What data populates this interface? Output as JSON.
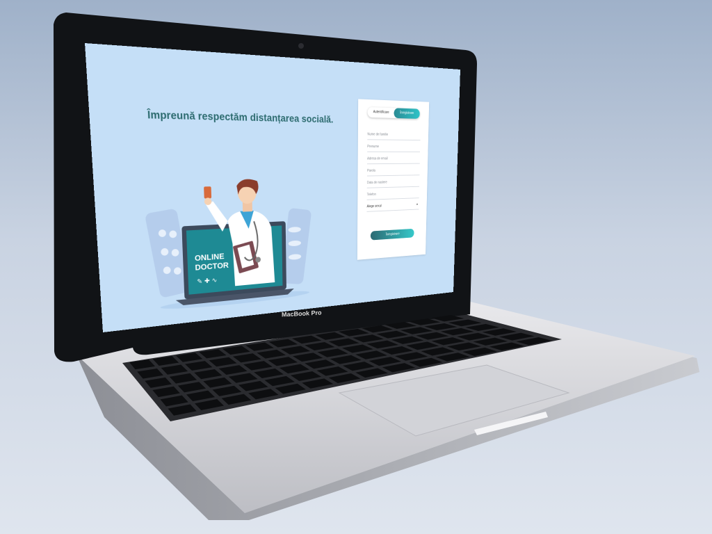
{
  "device": {
    "brand_label": "MacBook Pro"
  },
  "screen": {
    "tagline": "Împreună respectăm distanțarea socială.",
    "illustration": {
      "monitor_text_line1": "ONLINE",
      "monitor_text_line2": "DOCTOR"
    },
    "form": {
      "tabs": [
        {
          "label": "Autentificare",
          "active": false
        },
        {
          "label": "Înregistrare",
          "active": true
        }
      ],
      "fields": [
        {
          "placeholder": "Nume de familie"
        },
        {
          "placeholder": "Prenume"
        },
        {
          "placeholder": "Adresa de email"
        },
        {
          "placeholder": "Parola"
        },
        {
          "placeholder": "Data de nastere"
        },
        {
          "placeholder": "Telefon"
        }
      ],
      "sex_select": {
        "selected": "Alege sexul"
      },
      "submit_label": "Înregistrare"
    }
  },
  "colors": {
    "screen_bg": "#c5dff7",
    "accent_teal": "#2a8b94",
    "accent_cyan": "#36c8c9",
    "tagline": "#2b6a6e"
  },
  "icons": [
    "webcam-icon",
    "pill-icon",
    "stethoscope-icon",
    "clipboard-icon",
    "medicine-bottle-icon",
    "heartbeat-icon",
    "chevron-down-icon"
  ]
}
